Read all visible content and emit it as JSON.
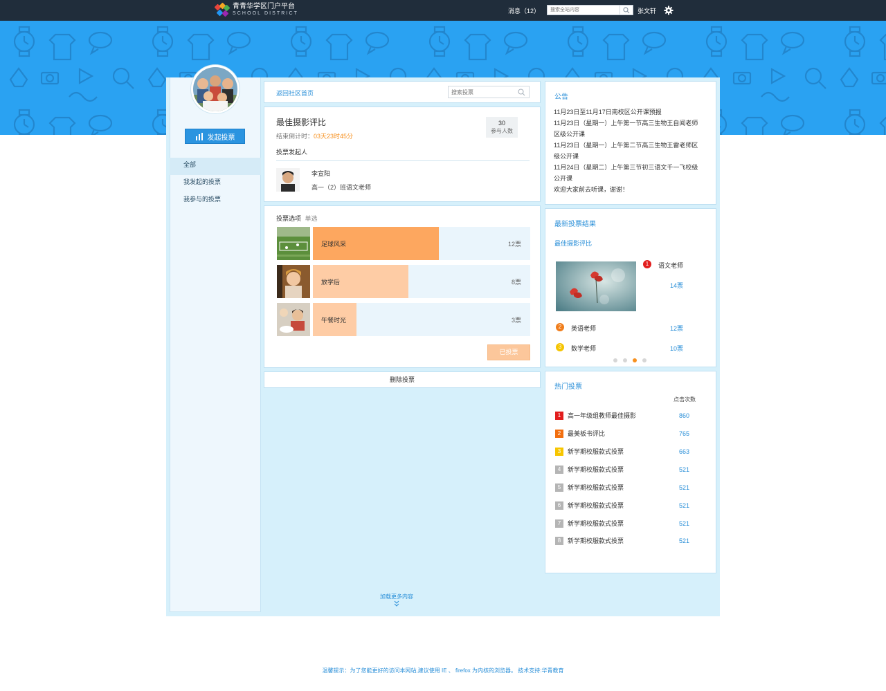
{
  "header": {
    "logo_cn": "青青华学区门户平台",
    "logo_en": "SCHOOL DISTRICT",
    "messages": "消息（12）",
    "search_placeholder": "搜索全站内容",
    "username": "张文轩"
  },
  "sidebar": {
    "start_vote": "发起投票",
    "items": [
      {
        "label": "全部",
        "active": true
      },
      {
        "label": "我发起的投票",
        "active": false
      },
      {
        "label": "我参与的投票",
        "active": false
      }
    ]
  },
  "main": {
    "back_link": "返回社区首页",
    "search_placeholder": "搜索投票",
    "poll": {
      "title": "最佳摄影评比",
      "countdown_label": "结束倒计时：",
      "countdown_value": "03天23时45分",
      "participants": "30",
      "participants_label": "参与人数",
      "initiator_label": "投票发起人",
      "initiator_name": "李宣阳",
      "initiator_role": "高一（2）班语文老师"
    },
    "options_label": "投票选项",
    "options_mode": "单选",
    "options": [
      {
        "label": "足球风采",
        "count": "12票",
        "fraction": 0.58,
        "color": "#fda75f"
      },
      {
        "label": "放学后",
        "count": "8票",
        "fraction": 0.44,
        "color": "#fecca5"
      },
      {
        "label": "午餐时光",
        "count": "3票",
        "fraction": 0.2,
        "color": "#fecca5"
      }
    ],
    "voted_button": "已投票",
    "delete_button": "删除投票",
    "load_more": "加载更多内容"
  },
  "notice": {
    "title": "公告",
    "lines": [
      "11月23日至11月17日南校区公开课预报",
      "11月23日（星期一）上午第一节高三生物王自闻老师",
      "区级公开课",
      "11月23日（星期一）上午第二节高三生物王雷老师区",
      "级公开课",
      "11月24日（星期二）上午第三节初三语文千一飞校级",
      "公开课",
      "欢迎大家前去听课，谢谢！"
    ]
  },
  "latest_results": {
    "title": "最新投票结果",
    "poll_name": "最佳摄影评比",
    "first": {
      "rank": "1",
      "name": "语文老师",
      "votes": "14票"
    },
    "others": [
      {
        "rank": "2",
        "name": "英语老师",
        "votes": "12票",
        "color": "#f07d1b"
      },
      {
        "rank": "3",
        "name": "数学老师",
        "votes": "10票",
        "color": "#f5c400"
      }
    ],
    "dots_active": 2
  },
  "hot_polls": {
    "title": "热门投票",
    "column_header": "点击次数",
    "items": [
      {
        "rank": "1",
        "title": "高一年级组教师最佳摄影",
        "clicks": "860",
        "color": "#e21e1e"
      },
      {
        "rank": "2",
        "title": "最美板书评比",
        "clicks": "765",
        "color": "#f26f0f"
      },
      {
        "rank": "3",
        "title": "新学期校服款式投票",
        "clicks": "663",
        "color": "#f7c600"
      },
      {
        "rank": "4",
        "title": "新学期校服款式投票",
        "clicks": "521",
        "color": "#b5b5b5"
      },
      {
        "rank": "5",
        "title": "新学期校服款式投票",
        "clicks": "521",
        "color": "#b5b5b5"
      },
      {
        "rank": "6",
        "title": "新学期校服款式投票",
        "clicks": "521",
        "color": "#b5b5b5"
      },
      {
        "rank": "7",
        "title": "新学期校服款式投票",
        "clicks": "521",
        "color": "#b5b5b5"
      },
      {
        "rank": "8",
        "title": "新学期校服款式投票",
        "clicks": "521",
        "color": "#b5b5b5"
      }
    ]
  },
  "footer": {
    "text": "温馨提示：为了您能更好的访问本网站,建议使用 IE 、 firefox 为内核的浏览器。 技术支持:华青教育"
  }
}
